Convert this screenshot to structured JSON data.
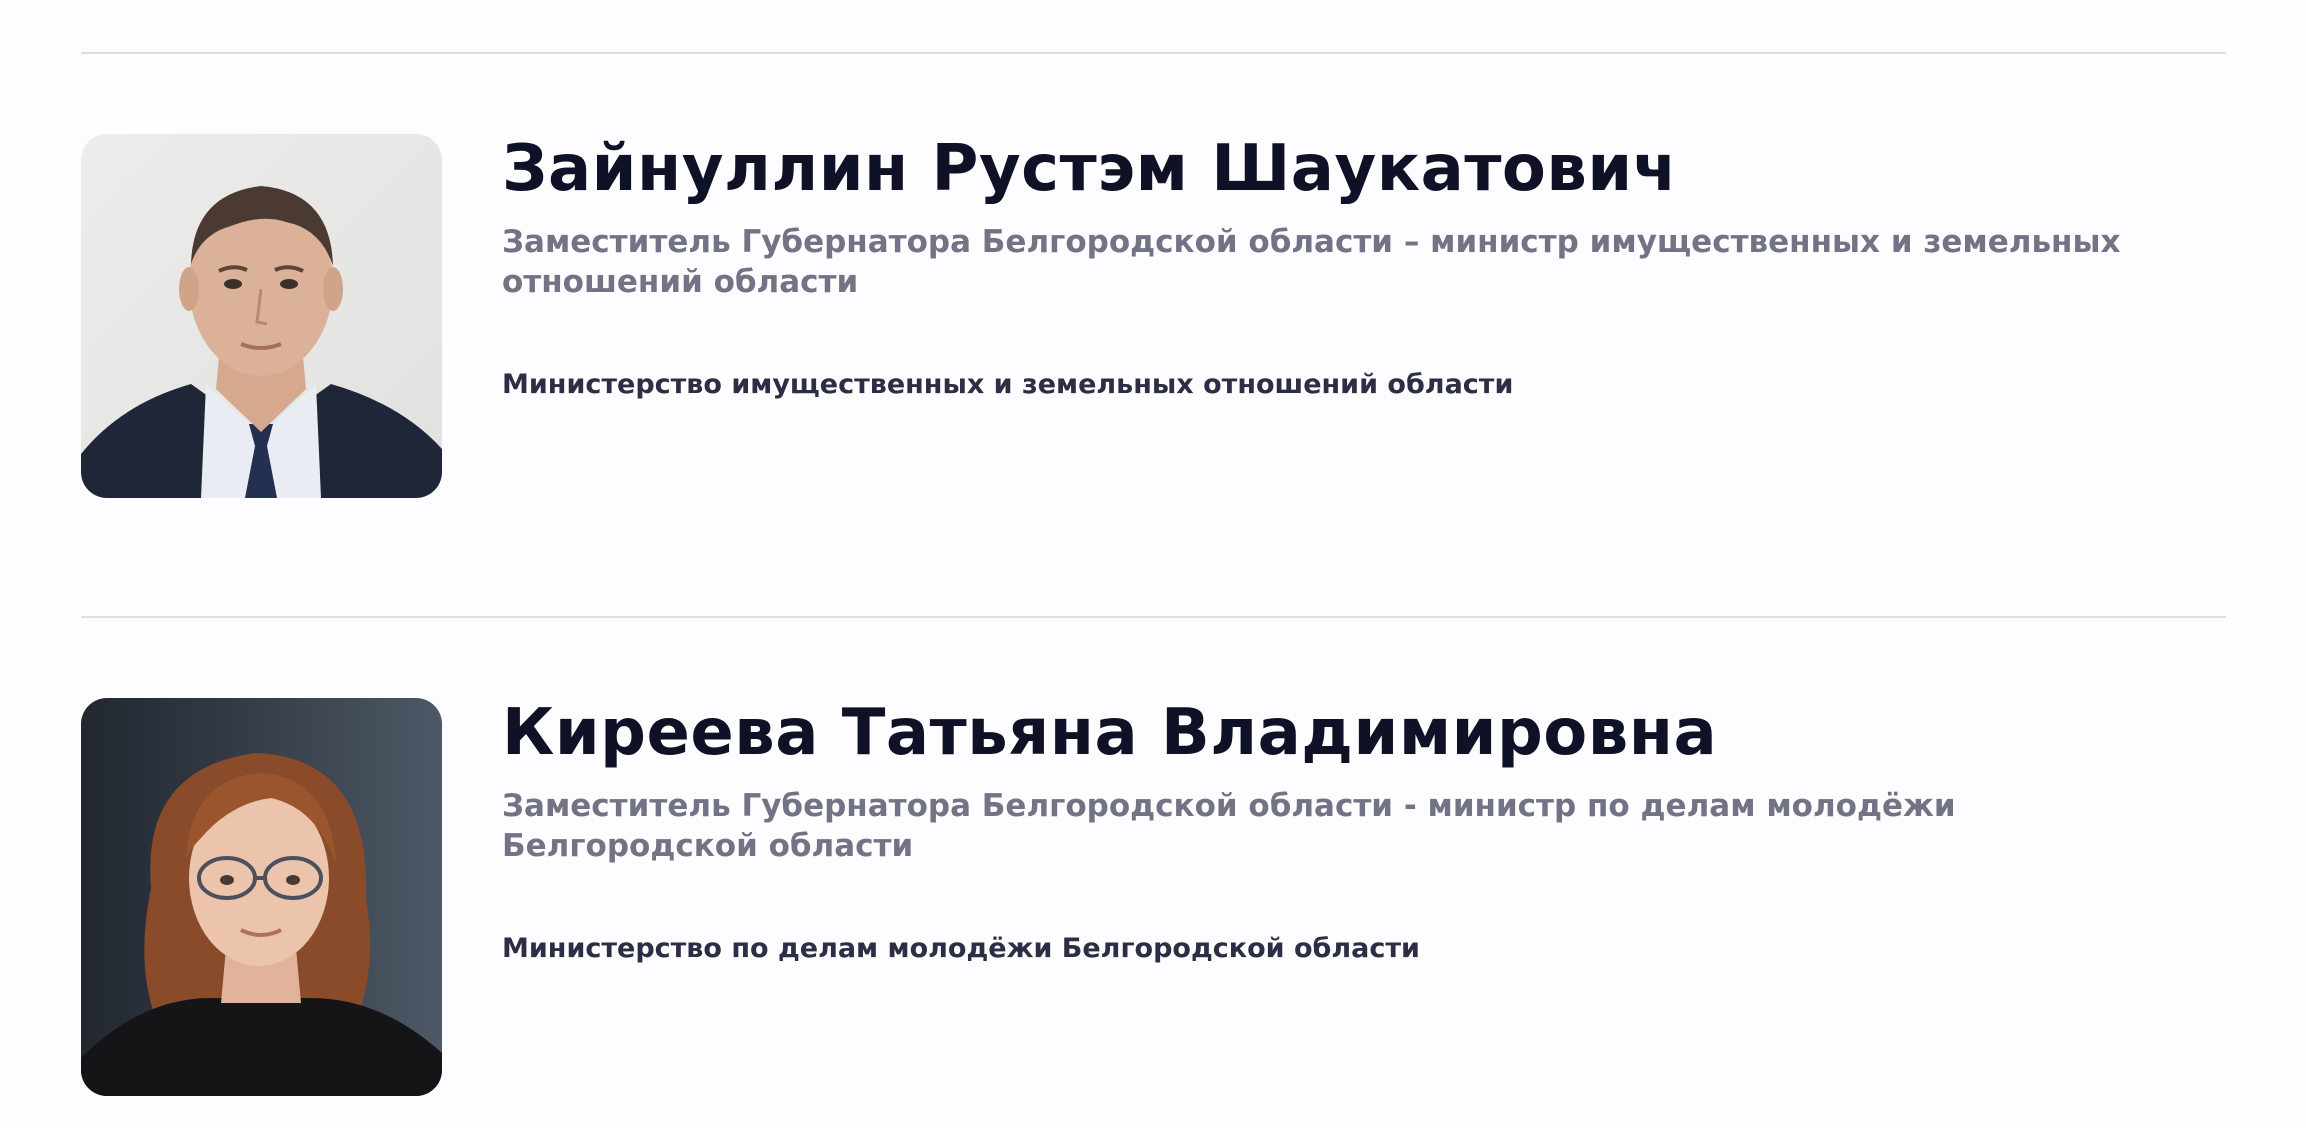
{
  "people": [
    {
      "name": "Зайнуллин Рустэм Шаукатович",
      "position": "Заместитель Губернатора Белгородской области – министр имущественных и земельных отношений области",
      "ministry": "Министерство имущественных и земельных отношений области"
    },
    {
      "name": "Киреева Татьяна Владимировна",
      "position": "Заместитель Губернатора Белгородской области - министр по делам молодёжи Белгородской области",
      "ministry": "Министерство по делам молодёжи Белгородской области"
    }
  ]
}
